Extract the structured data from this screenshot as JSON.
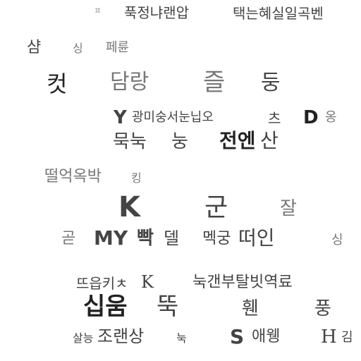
{
  "canvas": {
    "background": "#ffffff",
    "text_color_dark": "#222222",
    "text_color_mid": "#555555",
    "text_color_light": "#999999"
  },
  "rows": {
    "r1": [
      "ㅍ",
      "푹정냐랜압",
      "택는혜실일곡벤"
    ],
    "r2": [
      "샴",
      "싱",
      "페륜"
    ],
    "r3": [
      "컷",
      "담랑",
      "즐",
      "둥"
    ],
    "r4": [
      "Y",
      "광미숭서눈닙오",
      "츠",
      "D",
      "옹"
    ],
    "r5": [
      "묵눅",
      "눙",
      "전엔",
      "산"
    ],
    "r6": [
      "떨억옥박",
      "킹"
    ],
    "r7": [
      "K",
      "군",
      "잘"
    ],
    "r8": [
      "곧",
      "MY",
      "빡",
      "델",
      "멕궁",
      "떠인",
      "싱"
    ],
    "r9": [
      "뜨읍키ㅊ",
      "K",
      "눅갠부탈빗역료"
    ],
    "r10": [
      "십움",
      "뚝",
      "휀",
      "풍"
    ],
    "r11": [
      "살능",
      "조랜상",
      "눅",
      "S",
      "애웽",
      "H",
      "김"
    ]
  }
}
